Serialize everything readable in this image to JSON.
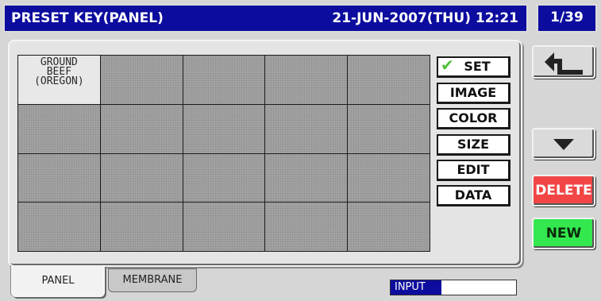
{
  "header": {
    "title": "PRESET KEY(PANEL)",
    "datetime": "21-JUN-2007(THU) 12:21",
    "page": "1/39"
  },
  "grid": {
    "rows": 4,
    "cols": 5,
    "cells": [
      "GROUND\nBEEF\n(OREGON)",
      "",
      "",
      "",
      "",
      "",
      "",
      "",
      "",
      "",
      "",
      "",
      "",
      "",
      "",
      "",
      "",
      "",
      "",
      ""
    ]
  },
  "options": [
    {
      "label": "SET",
      "checked": true
    },
    {
      "label": "IMAGE",
      "checked": false
    },
    {
      "label": "COLOR",
      "checked": false
    },
    {
      "label": "SIZE",
      "checked": false
    },
    {
      "label": "EDIT",
      "checked": false
    },
    {
      "label": "DATA",
      "checked": false
    }
  ],
  "side": {
    "back_icon": "back-arrow-icon",
    "down_icon": "down-triangle-icon",
    "delete_label": "DELETE",
    "new_label": "NEW"
  },
  "tabs": [
    {
      "label": "PANEL",
      "active": true
    },
    {
      "label": "MEMBRANE",
      "active": false
    }
  ],
  "input_label": "INPUT",
  "input_value": "",
  "colors": {
    "title_bg": "#0c0c9e",
    "delete": "#f24646",
    "new": "#33e84f",
    "check": "#4ec23a"
  }
}
